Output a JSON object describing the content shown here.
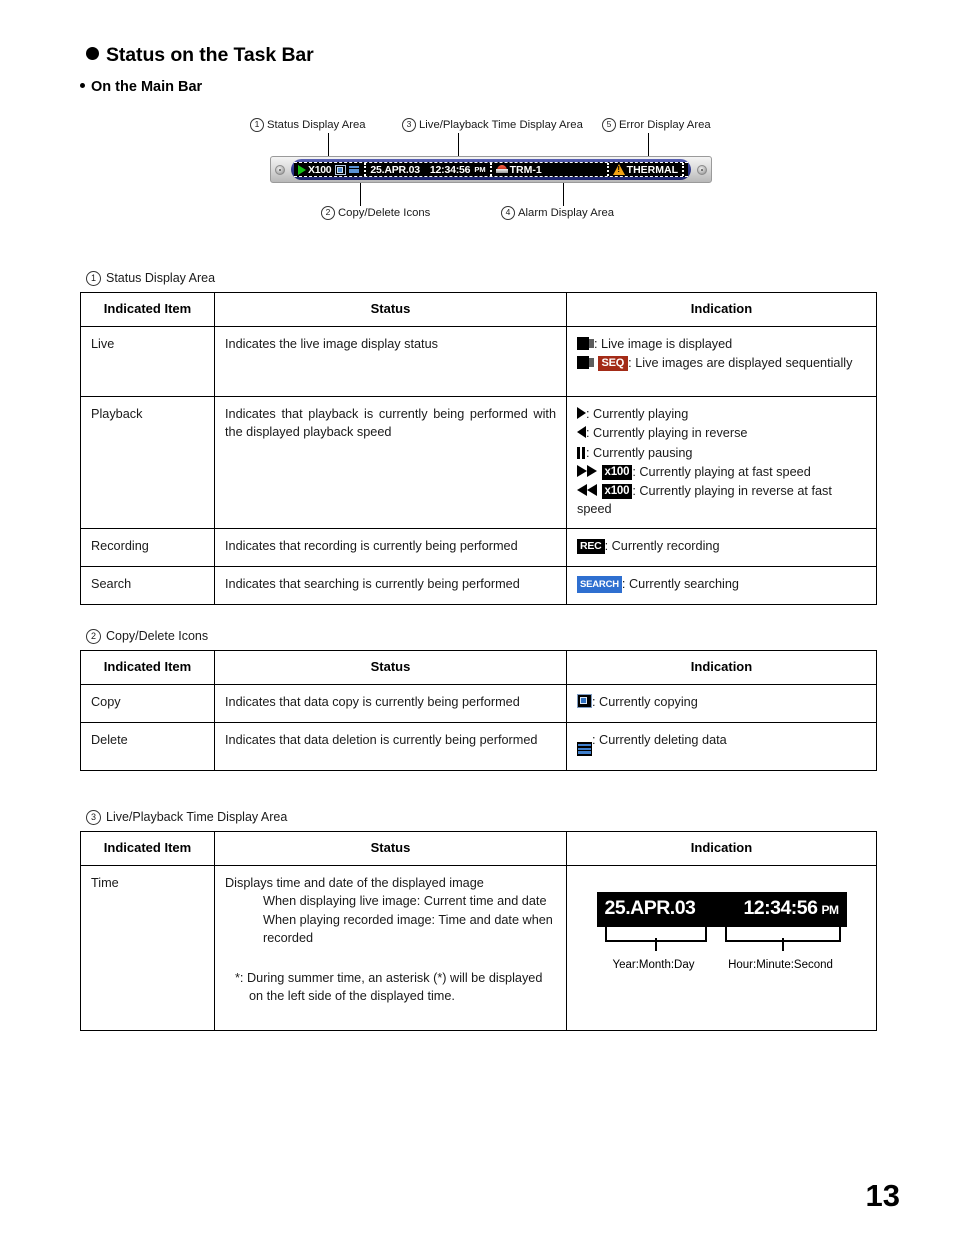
{
  "page": {
    "heading": "Status on the Task Bar",
    "sub_heading": "On the Main Bar",
    "page_number": "13"
  },
  "diagram": {
    "callouts": {
      "status_display": {
        "num": "1",
        "label": "Status Display Area"
      },
      "live_playback_time": {
        "num": "3",
        "label": "Live/Playback Time Display Area"
      },
      "error_display": {
        "num": "5",
        "label": "Error Display Area"
      },
      "copy_delete": {
        "num": "2",
        "label": "Copy/Delete Icons"
      },
      "alarm_display": {
        "num": "4",
        "label": "Alarm Display Area"
      }
    },
    "taskbar": {
      "speed": "X100",
      "date": "25.APR.03",
      "time": "12:34:56",
      "ampm": "PM",
      "alarm_text": "TRM-1",
      "error_text": "THERMAL"
    }
  },
  "sections": [
    {
      "num": "1",
      "caption": "Status Display Area",
      "headers": [
        "Indicated Item",
        "Status",
        "Indication"
      ],
      "rows": [
        {
          "item": "Live",
          "status": "Indicates the live image display status",
          "indications": [
            {
              "icon": "live-icon",
              "text": ": Live image is displayed"
            },
            {
              "icon": "live-icon",
              "badge": "SEQ",
              "text": ": Live images are displayed sequentially"
            }
          ]
        },
        {
          "item": "Playback",
          "status": "Indicates that playback is currently being performed with the displayed playback speed",
          "indications": [
            {
              "icon": "play-icon",
              "text": ": Currently playing"
            },
            {
              "icon": "play-reverse-icon",
              "text": ": Currently playing in reverse"
            },
            {
              "icon": "pause-icon",
              "text": ": Currently pausing"
            },
            {
              "icon": "fast-forward-icon",
              "badge": "x100",
              "text": ": Currently playing at fast speed"
            },
            {
              "icon": "fast-rewind-icon",
              "badge": "x100",
              "text": ": Currently playing in reverse at fast speed"
            }
          ]
        },
        {
          "item": "Recording",
          "status": "Indicates that recording is currently being performed",
          "indications": [
            {
              "badge": "REC",
              "text": ": Currently recording"
            }
          ]
        },
        {
          "item": "Search",
          "status": "Indicates that searching is currently being performed",
          "indications": [
            {
              "badge": "SEARCH",
              "text": ": Currently searching"
            }
          ]
        }
      ]
    },
    {
      "num": "2",
      "caption": "Copy/Delete Icons",
      "headers": [
        "Indicated Item",
        "Status",
        "Indication"
      ],
      "rows": [
        {
          "item": "Copy",
          "status": "Indicates that data copy is currently being performed",
          "indications": [
            {
              "icon": "copy-icon",
              "text": ": Currently copying"
            }
          ]
        },
        {
          "item": "Delete",
          "status": "Indicates that data deletion is currently being performed",
          "indications": [
            {
              "icon": "delete-icon",
              "text": ": Currently deleting data"
            }
          ]
        }
      ]
    },
    {
      "num": "3",
      "caption": "Live/Playback Time Display Area",
      "headers": [
        "Indicated Item",
        "Status",
        "Indication"
      ],
      "rows": [
        {
          "item": "Time",
          "status_lines": [
            "Displays time and date of the displayed image",
            "When displaying live image: Current time and date",
            "When playing recorded image: Time and date when recorded",
            "*: During summer time, an asterisk (*) will be displayed on the left side of the displayed time."
          ],
          "time_figure": {
            "date": "25.APR.03",
            "time": "12:34:56",
            "ampm": "PM",
            "date_label": "Year:Month:Day",
            "time_label": "Hour:Minute:Second"
          }
        }
      ]
    }
  ],
  "colors": {
    "seq_badge": "#a32b17",
    "search_badge": "#2e6fd0",
    "rec_badge": "#000000",
    "taskbar_blue": "#313a8e",
    "play_green": "#16c116",
    "warning_orange": "#f3a413"
  }
}
